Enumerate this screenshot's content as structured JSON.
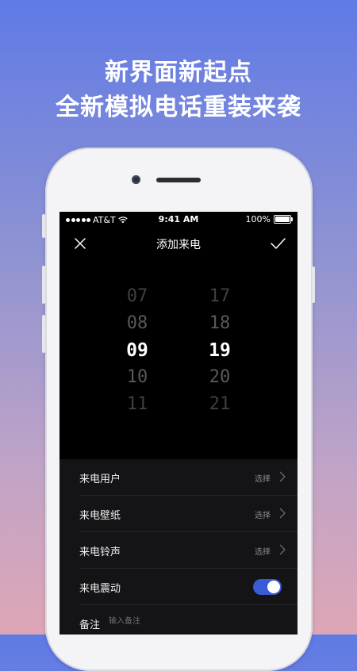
{
  "banner": {
    "line1": "新界面新起点",
    "line2": "全新模拟电话重装来袭"
  },
  "status_bar": {
    "carrier": "AT&T",
    "time": "9:41 AM",
    "battery": "100%",
    "battery_level": 1.0
  },
  "nav": {
    "title": "添加来电"
  },
  "picker": {
    "hours": [
      "07",
      "08",
      "09",
      "10",
      "11"
    ],
    "minutes": [
      "17",
      "18",
      "19",
      "20",
      "21"
    ],
    "selected_hour": "09",
    "selected_minute": "19"
  },
  "settings": [
    {
      "label": "来电用户",
      "hint": "选择"
    },
    {
      "label": "来电壁纸",
      "hint": "选择"
    },
    {
      "label": "来电铃声",
      "hint": "选择"
    },
    {
      "label": "来电震动",
      "toggle_on": true
    }
  ],
  "note": {
    "label": "备注",
    "placeholder": "输入备注"
  },
  "colors": {
    "toggle_on": "#3b5bd6",
    "bg_top": "#5f7ae6",
    "bg_bottom": "#dea6b5"
  }
}
